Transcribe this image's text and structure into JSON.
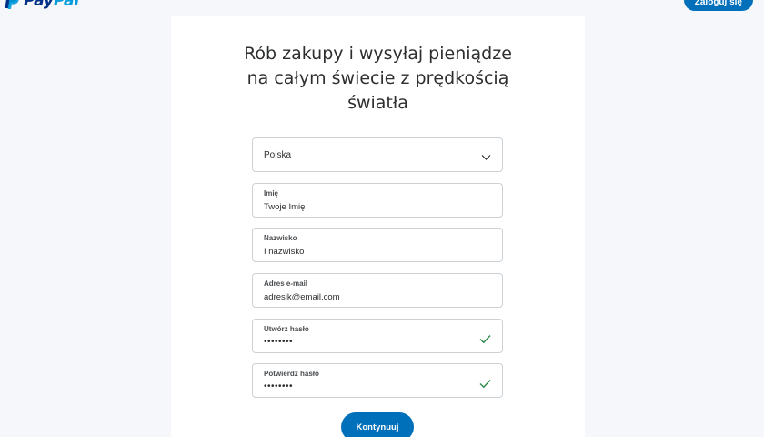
{
  "header": {
    "logo_pay": "Pay",
    "logo_pal": "Pal",
    "login_label": "Zaloguj się"
  },
  "main": {
    "title_lines": [
      "Rób zakupy i wysyłaj pieniądze",
      "na całym świecie z prędkością",
      "światła"
    ],
    "country": {
      "value": "Polska",
      "icon": "chevron-down-icon"
    },
    "first_name": {
      "label": "Imię",
      "value": "Twoje Imię"
    },
    "last_name": {
      "label": "Nazwisko",
      "value": "I nazwisko"
    },
    "email": {
      "label": "Adres e-mail",
      "value": "adresik@email.com"
    },
    "password": {
      "label": "Utwórz hasło",
      "value": "••••••••",
      "valid_icon": "checkmark-icon"
    },
    "password_confirm": {
      "label": "Potwierdź hasło",
      "value": "••••••••",
      "valid_icon": "checkmark-icon"
    },
    "continue_label": "Kontynuuj"
  },
  "colors": {
    "brand_blue": "#0070ba",
    "logo_dark": "#003087",
    "logo_light": "#009cde",
    "valid_green": "#2e8a4a",
    "border": "#ccd1d6"
  }
}
